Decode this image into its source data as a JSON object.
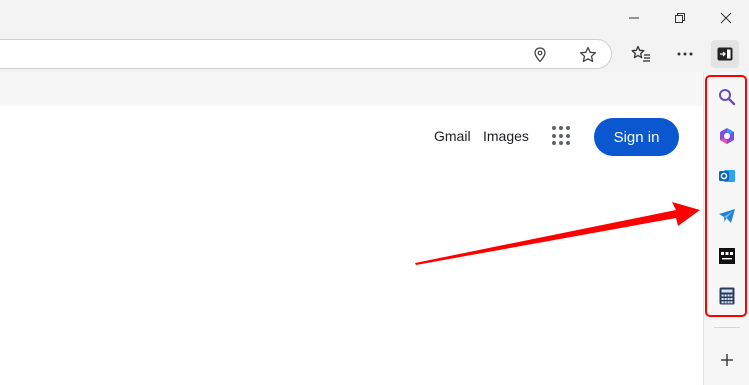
{
  "window": {
    "minimize_icon": "minimize-icon",
    "restore_icon": "restore-icon",
    "close_icon": "close-icon"
  },
  "toolbar": {
    "address_icons": [
      "location-icon",
      "add-favorite-star-icon"
    ],
    "buttons": [
      "favorites-icon",
      "more-options-icon",
      "sidebar-toggle-icon"
    ]
  },
  "google": {
    "gmail": "Gmail",
    "images": "Images",
    "apps_icon": "google-apps-icon",
    "sign_in": "Sign in"
  },
  "sidebar": {
    "items": [
      "search-icon",
      "copilot-icon",
      "outlook-icon",
      "telegram-icon",
      "bbc-news-icon",
      "calculator-icon"
    ],
    "add_icon": "add-icon"
  },
  "annotation": {
    "highlight_color": "#ff0000",
    "arrow_color": "#ff0000"
  },
  "colors": {
    "signin_bg": "#0b57d0",
    "chrome_bg": "#f3f3f3"
  }
}
